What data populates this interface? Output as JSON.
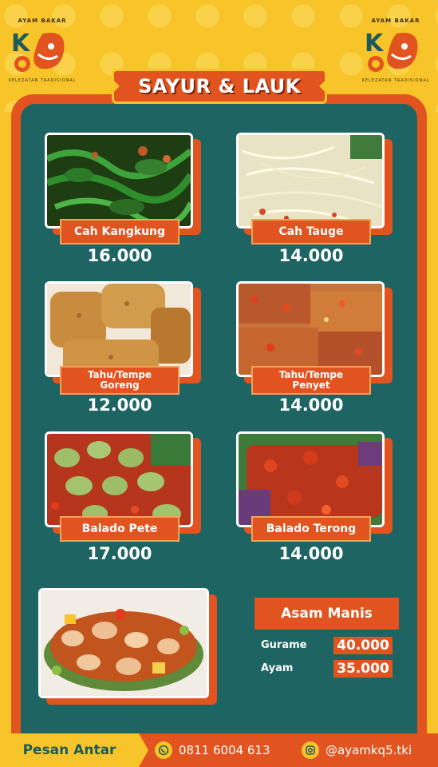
{
  "brand": {
    "small_text": "AYAM BAKAR",
    "tagline": "KELEZATAN TRADISIONAL",
    "logo_letters": "KQ5"
  },
  "title": "SAYUR & LAUK",
  "menu": [
    {
      "name": "Cah Kangkung",
      "price": "16.000"
    },
    {
      "name": "Cah Tauge",
      "price": "14.000"
    },
    {
      "name": "Tahu/Tempe Goreng",
      "name_line1": "Tahu/Tempe",
      "name_line2": "Goreng",
      "price": "12.000"
    },
    {
      "name": "Tahu/Tempe Penyet",
      "name_line1": "Tahu/Tempe",
      "name_line2": "Penyet",
      "price": "14.000"
    },
    {
      "name": "Balado Pete",
      "price": "17.000"
    },
    {
      "name": "Balado Terong",
      "price": "14.000"
    }
  ],
  "asam_manis": {
    "title": "Asam Manis",
    "items": [
      {
        "name": "Gurame",
        "price": "40.000"
      },
      {
        "name": "Ayam",
        "price": "35.000"
      }
    ]
  },
  "footer": {
    "cta": "Pesan Antar",
    "phone": "0811 6004 613",
    "instagram": "@ayamkq5.tki",
    "phone_icon": "whatsapp-icon",
    "ig_icon": "instagram-icon"
  },
  "colors": {
    "orange": "#e2541f",
    "teal": "#1d6462",
    "yellow": "#f7c52a"
  }
}
